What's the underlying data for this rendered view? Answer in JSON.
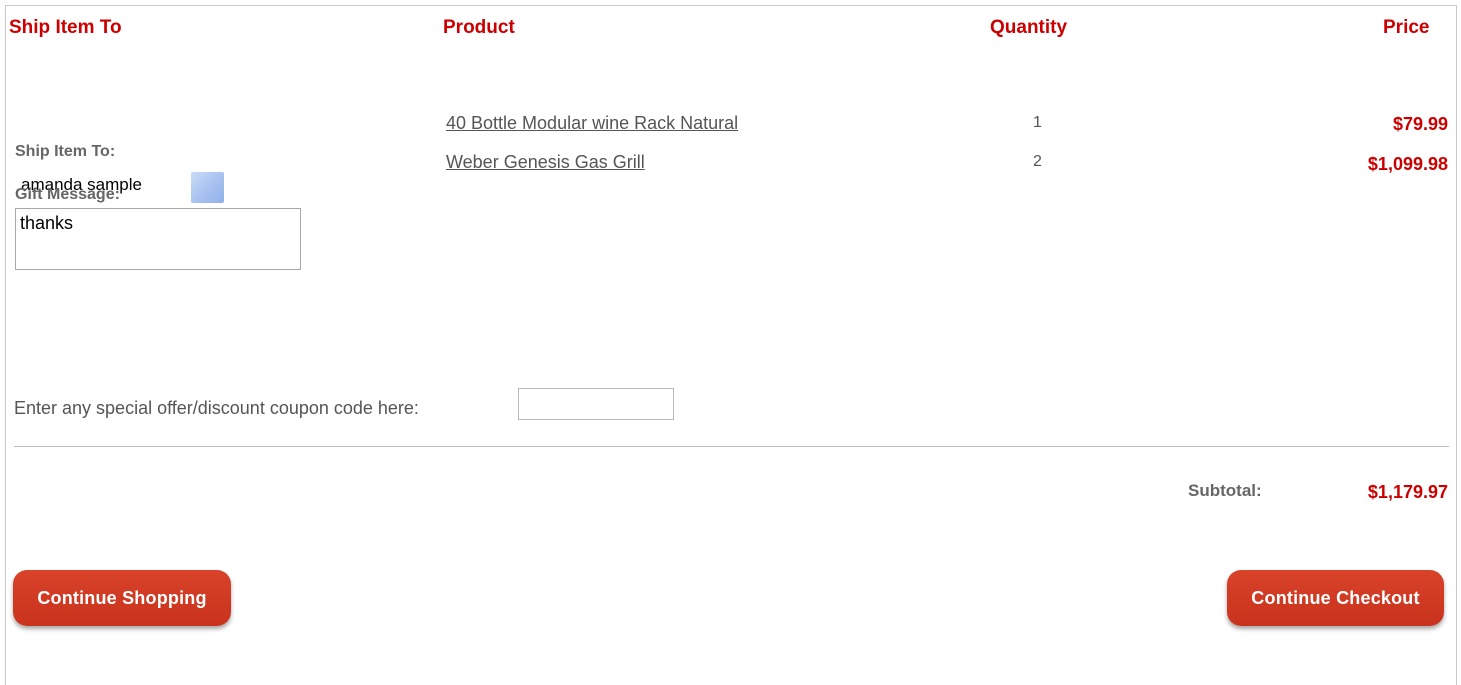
{
  "columns": {
    "ship_to": "Ship Item To",
    "product": "Product",
    "quantity": "Quantity",
    "price": "Price"
  },
  "shipping": {
    "ship_label": "Ship Item To:",
    "recipient": "amanda sample",
    "gift_label": "Gift Message:",
    "gift_message": "thanks"
  },
  "items": [
    {
      "name": "40 Bottle Modular wine Rack Natural",
      "qty": "1",
      "price": "$79.99"
    },
    {
      "name": "Weber Genesis Gas Grill",
      "qty": "2",
      "price": "$1,099.98"
    }
  ],
  "coupon": {
    "label": "Enter any special offer/discount coupon code here:",
    "value": ""
  },
  "summary": {
    "subtotal_label": "Subtotal:",
    "subtotal_value": "$1,179.97"
  },
  "actions": {
    "continue_shopping": "Continue Shopping",
    "continue_checkout": "Continue Checkout"
  },
  "colors": {
    "accent": "#cc0000",
    "button": "#c9321c"
  },
  "icons": {
    "edit_recipient": "edit-icon"
  }
}
